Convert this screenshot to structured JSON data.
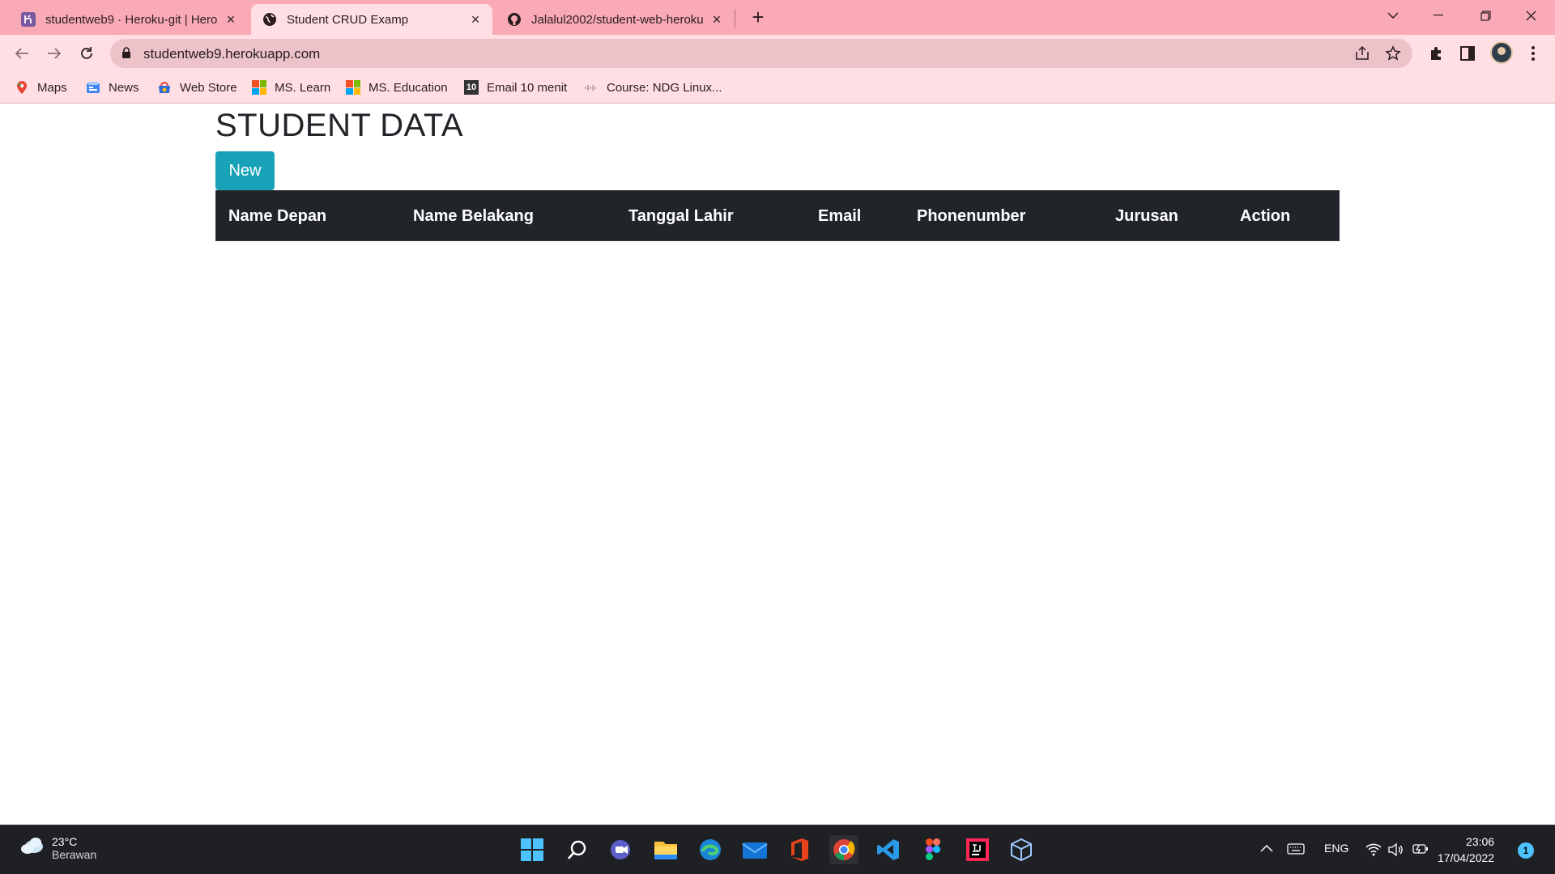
{
  "browser": {
    "tabs": [
      {
        "title": "studentweb9 · Heroku-git | Herol",
        "icon": "heroku-icon",
        "active": false
      },
      {
        "title": "Student CRUD Examp",
        "icon": "globe-icon",
        "active": true
      },
      {
        "title": "Jalalul2002/student-web-heroku",
        "icon": "github-icon",
        "active": false
      }
    ],
    "url": "studentweb9.herokuapp.com",
    "bookmarks": [
      {
        "label": "Maps",
        "icon": "maps-icon"
      },
      {
        "label": "News",
        "icon": "news-icon"
      },
      {
        "label": "Web Store",
        "icon": "webstore-icon"
      },
      {
        "label": "MS. Learn",
        "icon": "microsoft-icon"
      },
      {
        "label": "MS. Education",
        "icon": "microsoft-icon"
      },
      {
        "label": "Email 10 menit",
        "icon": "email10-icon"
      },
      {
        "label": "Course: NDG Linux...",
        "icon": "cisco-icon"
      }
    ]
  },
  "page": {
    "title": "STUDENT DATA",
    "new_button": "New",
    "table": {
      "headers": [
        "Name Depan",
        "Name Belakang",
        "Tanggal Lahir",
        "Email",
        "Phonenumber",
        "Jurusan",
        "Action"
      ],
      "rows": []
    }
  },
  "taskbar": {
    "weather": {
      "temp": "23°C",
      "condition": "Berawan"
    },
    "apps": [
      "start-icon",
      "search-icon",
      "teams-icon",
      "file-explorer-icon",
      "edge-icon",
      "mail-icon",
      "office-icon",
      "chrome-icon",
      "vscode-icon",
      "figma-icon",
      "intellij-icon",
      "virtualbox-icon"
    ],
    "language": "ENG",
    "time": "23:06",
    "date": "17/04/2022",
    "notifications": "1"
  },
  "colors": {
    "tabstrip": "#f9aab6",
    "toolbar": "#ffdfe4",
    "button": "#17a2b8",
    "table_header": "#212529",
    "taskbar": "#1f2023"
  }
}
